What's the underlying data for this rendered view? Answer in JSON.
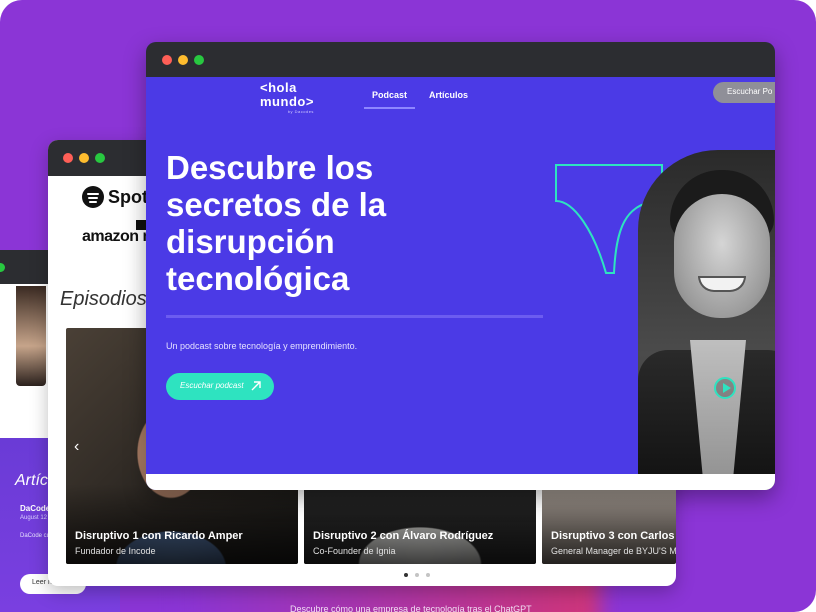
{
  "front_window": {
    "logo_line1": "<hola",
    "logo_line2": "mundo>",
    "logo_small": "by Dacodes",
    "nav": [
      {
        "label": "Podcast"
      },
      {
        "label": "Artículos"
      }
    ],
    "listen_top": "Escuchar Po",
    "headline": "Descubre los secretos de la disrupción tecnológica",
    "subtitle": "Un podcast sobre tecnología y emprendimiento.",
    "cta": "Escuchar podcast"
  },
  "middle_window": {
    "platform_1": "Spotif",
    "platform_2": "amazon m",
    "section_title": "Episodios",
    "episodes": [
      {
        "title": "Disruptivo 1 con Ricardo Amper",
        "subtitle": "Fundador de Incode"
      },
      {
        "title": "Disruptivo 2 con Álvaro Rodríguez",
        "subtitle": "Co-Founder de Ignia"
      },
      {
        "title": "Disruptivo 3 con Carlos",
        "subtitle": "General Manager de BYJU'S Ma"
      }
    ],
    "carousel_prev": "‹"
  },
  "back_window": {
    "section_title": "Artíc",
    "article_author": "DaCode",
    "article_date": "August 12",
    "article_text": "DaCode cumplim bienesta",
    "read_more": "Leer n.."
  },
  "footer_hint": "Descubre cómo una empresa de tecnología tras el ChatGPT",
  "colors": {
    "background": "#8b35d6",
    "hero": "#4b3ae6",
    "accent": "#2ee3c0"
  }
}
